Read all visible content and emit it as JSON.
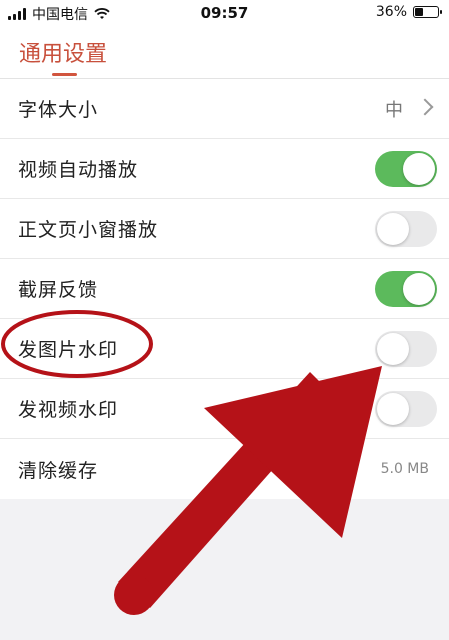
{
  "status_bar": {
    "carrier": "中国电信",
    "time": "09:57",
    "battery": "36%",
    "battery_level": 0.36
  },
  "header": {
    "tab_label": "通用设置"
  },
  "settings": [
    {
      "label": "字体大小",
      "value": "中",
      "type": "nav"
    },
    {
      "label": "视频自动播放",
      "type": "toggle",
      "on": true
    },
    {
      "label": "正文页小窗播放",
      "type": "toggle",
      "on": false
    },
    {
      "label": "截屏反馈",
      "type": "toggle",
      "on": true
    },
    {
      "label": "发图片水印",
      "type": "toggle",
      "on": false
    },
    {
      "label": "发视频水印",
      "type": "toggle",
      "on": false
    },
    {
      "label": "清除缓存",
      "value": "5.0 MB",
      "type": "value"
    }
  ],
  "colors": {
    "accent": "#c8503c",
    "toggle_on": "#5cba5c",
    "annotation": "#b51218"
  },
  "icons": [
    "wifi-icon",
    "signal-icon",
    "battery-icon",
    "chevron-right-icon"
  ]
}
